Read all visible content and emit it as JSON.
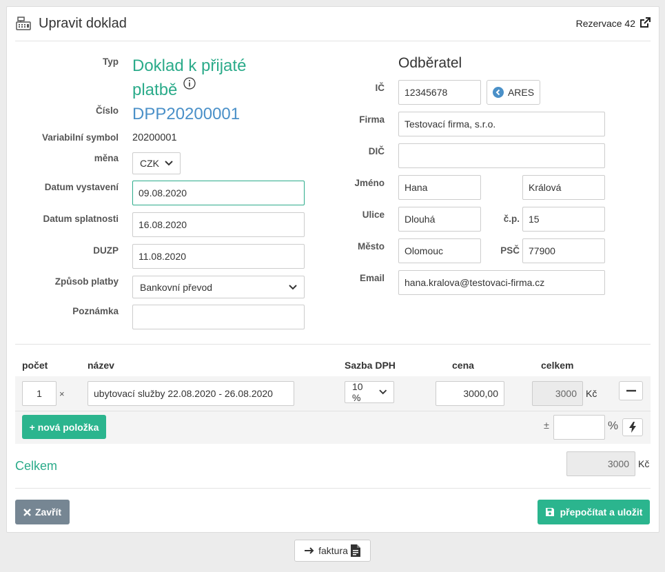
{
  "header": {
    "title": "Upravit doklad",
    "reservation_link": "Rezervace 42"
  },
  "left": {
    "typ_label": "Typ",
    "typ_value": "Doklad k přijaté platbě",
    "cislo_label": "Číslo",
    "cislo_value": "DPP20200001",
    "vs_label": "Variabilní symbol",
    "vs_value": "20200001",
    "mena_label": "měna",
    "mena_value": "CZK",
    "datum_vystaveni_label": "Datum vystavení",
    "datum_vystaveni_value": "09.08.2020",
    "datum_splatnosti_label": "Datum splatnosti",
    "datum_splatnosti_value": "16.08.2020",
    "duzp_label": "DUZP",
    "duzp_value": "11.08.2020",
    "zpusob_platby_label": "Způsob platby",
    "zpusob_platby_value": "Bankovní převod",
    "poznamka_label": "Poznámka",
    "poznamka_value": ""
  },
  "customer": {
    "title": "Odběratel",
    "ic_label": "IČ",
    "ic_value": "12345678",
    "ares_button": "ARES",
    "firma_label": "Firma",
    "firma_value": "Testovací firma, s.r.o.",
    "dic_label": "DIČ",
    "dic_value": "",
    "jmeno_label": "Jméno",
    "jmeno_value": "Hana",
    "prijmeni_value": "Králová",
    "ulice_label": "Ulice",
    "ulice_value": "Dlouhá",
    "cp_label": "č.p.",
    "cp_value": "15",
    "mesto_label": "Město",
    "mesto_value": "Olomouc",
    "psc_label": "PSČ",
    "psc_value": "77900",
    "email_label": "Email",
    "email_value": "hana.kralova@testovaci-firma.cz"
  },
  "items": {
    "headers": {
      "pocet": "počet",
      "nazev": "název",
      "sazba": "Sazba DPH",
      "cena": "cena",
      "celkem": "celkem"
    },
    "rows": [
      {
        "pocet": "1",
        "times": "×",
        "nazev": "ubytovací služby 22.08.2020 - 26.08.2020",
        "sazba": "10 %",
        "cena": "3000,00",
        "celkem": "3000",
        "currency": "Kč"
      }
    ],
    "new_item_button": "+ nová položka",
    "discount_prefix": "±",
    "discount_value": "",
    "discount_suffix": "%"
  },
  "total": {
    "label": "Celkem",
    "value": "3000",
    "currency": "Kč"
  },
  "footer": {
    "close_button": "Zavřít",
    "save_button": "přepočítat a uložit"
  },
  "below": {
    "faktura_button": "faktura"
  },
  "colors": {
    "accent": "#2bab8a",
    "link_blue": "#4a90c8",
    "close_grey": "#768693"
  }
}
